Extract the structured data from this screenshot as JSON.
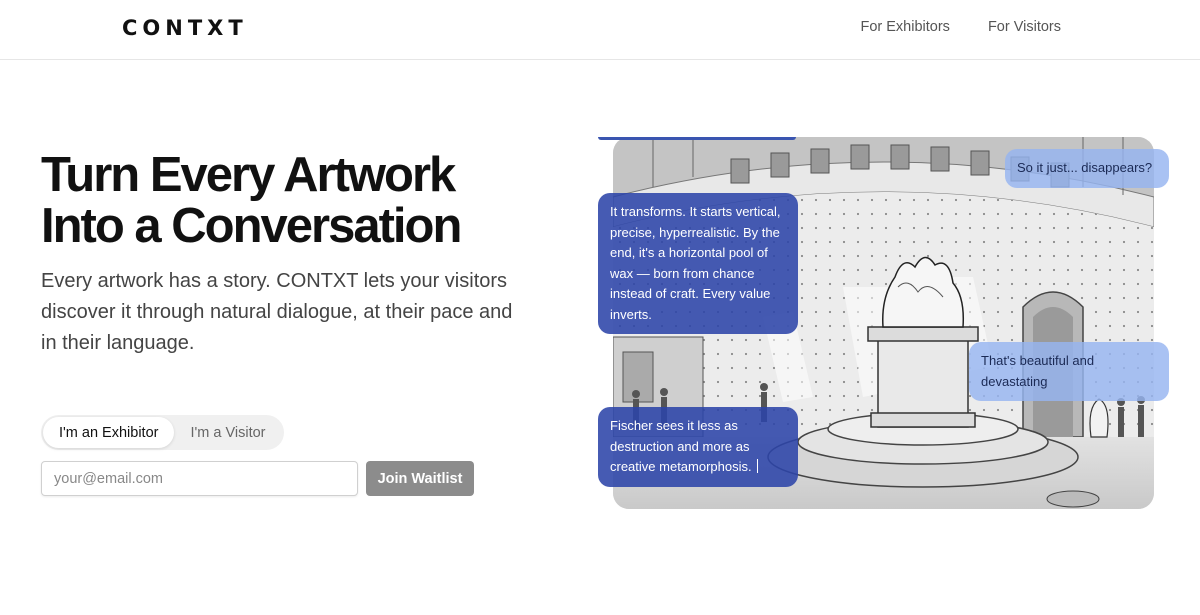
{
  "header": {
    "logo": "CONTXT",
    "nav": [
      "For Exhibitors",
      "For Visitors"
    ]
  },
  "hero": {
    "title_line1": "Turn Every Artwork",
    "title_line2": "Into a Conversation",
    "subtitle": "Every artwork has a story. CONTXT lets your visitors discover it through natural dialogue, at their pace and in their language."
  },
  "toggle": {
    "options": [
      "I'm an Exhibitor",
      "I'm a Visitor"
    ],
    "selected": "I'm an Exhibitor"
  },
  "waitlist": {
    "email_placeholder": "your@email.com",
    "email_value": "",
    "button_label": "Join Waitlist"
  },
  "chat": [
    {
      "role": "user",
      "text": "So it just... disappears?"
    },
    {
      "role": "ai",
      "text": "It transforms. It starts vertical, precise, hyperrealistic. By the end, it's a horizontal pool of wax — born from chance instead of craft. Every value inverts."
    },
    {
      "role": "user",
      "text": "That's beautiful and devastating"
    },
    {
      "role": "ai",
      "text": "Fischer sees it less as destruction and more as creative metamorphosis."
    }
  ],
  "colors": {
    "ai_bubble": "#2c44a8",
    "user_bubble": "#96b4f0",
    "button_bg": "#8c8c8c",
    "title_text": "#111111"
  }
}
